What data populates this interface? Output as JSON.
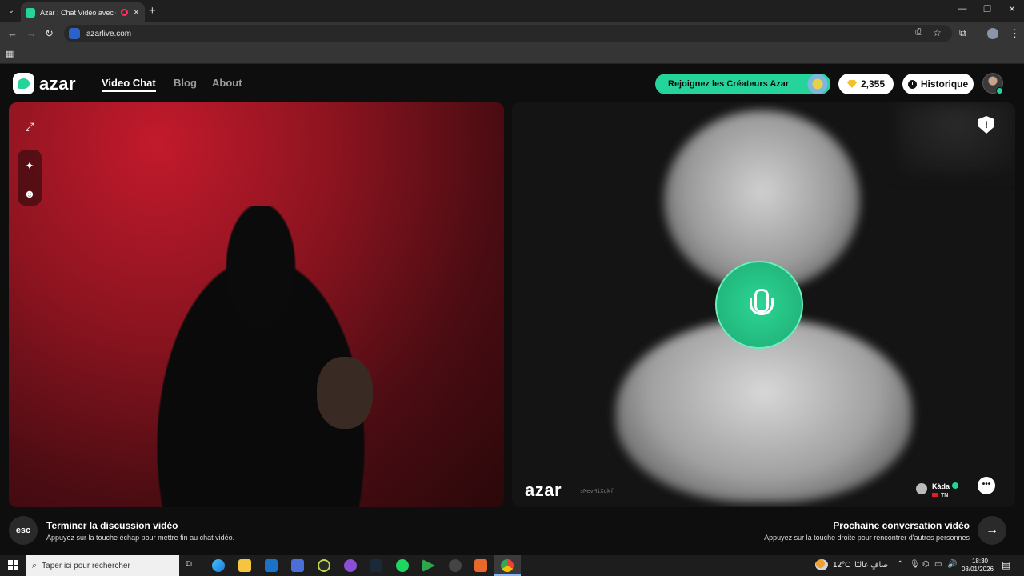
{
  "browser": {
    "tab_title": "Azar : Chat Vidéo avec de n",
    "url": "azarlive.com"
  },
  "header": {
    "logo_text": "azar",
    "nav": {
      "video_chat": "Video Chat",
      "blog": "Blog",
      "about": "About"
    },
    "creators_label": "Rejoignez les Créateurs Azar",
    "gems_count": "2,355",
    "history_label": "Historique"
  },
  "partner": {
    "watermark_logo": "azar",
    "watermark_id": "sMevMiXqkf",
    "name": "Kàda",
    "country": "TN"
  },
  "hints": {
    "esc_key": "esc",
    "end_title": "Terminer la discussion vidéo",
    "end_sub": "Appuyez sur la touche échap pour mettre fin au chat vidéo.",
    "next_title": "Prochaine conversation vidéo",
    "next_sub": "Appuyez sur la touche droite pour rencontrer d'autres personnes",
    "next_arrow": "→"
  },
  "taskbar": {
    "search_placeholder": "Taper ici pour rechercher",
    "weather_temp": "12°C",
    "weather_text": "صافٍ غالبًا",
    "time": "18:30",
    "date": "08/01/2026"
  },
  "colors": {
    "accent": "#25d49a",
    "bg": "#0e0e0e"
  }
}
